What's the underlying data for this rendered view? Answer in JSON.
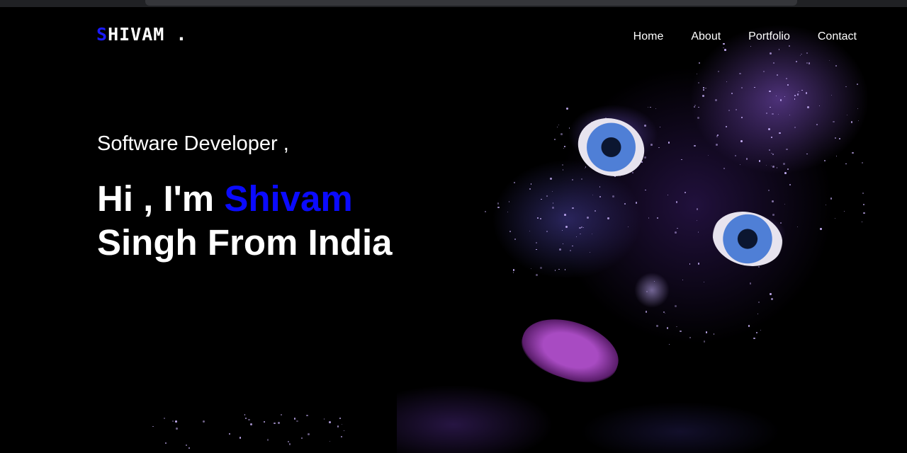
{
  "logo": {
    "first_letter": "S",
    "rest": "HIVAM",
    "dot": "."
  },
  "nav": {
    "items": [
      {
        "label": "Home"
      },
      {
        "label": "About"
      },
      {
        "label": "Portfolio"
      },
      {
        "label": "Contact"
      }
    ]
  },
  "hero": {
    "subtitle": "Software Developer ,",
    "greeting": "Hi , I'm ",
    "name_highlight": "Shivam",
    "line2": "Singh From India"
  },
  "colors": {
    "accent": "#0b0bff",
    "background": "#000000",
    "text": "#ffffff"
  }
}
